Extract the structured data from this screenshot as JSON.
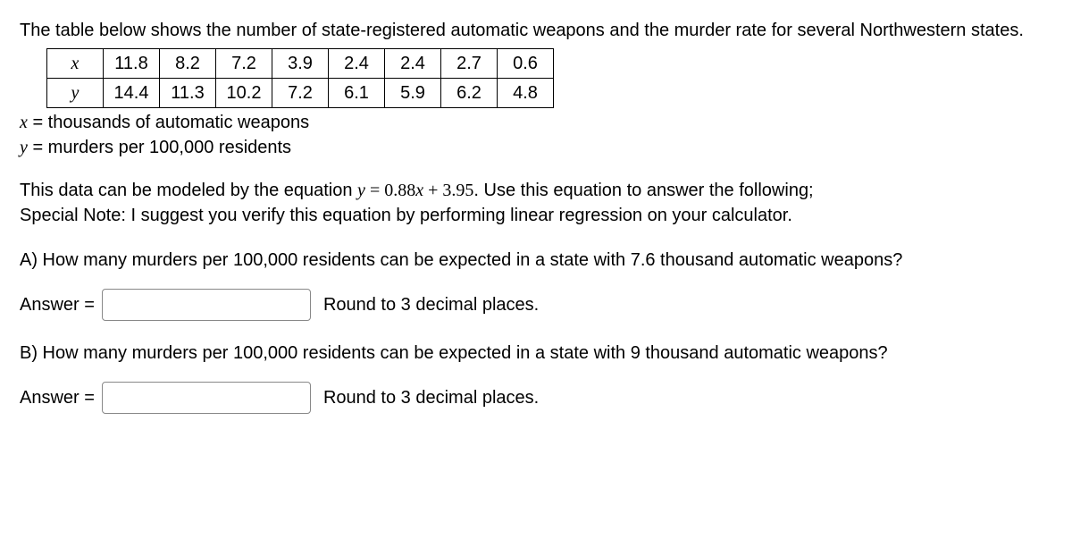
{
  "intro": "The table below shows the number of state-registered automatic weapons and the murder rate for several Northwestern states.",
  "table": {
    "row_x_label": "x",
    "row_y_label": "y",
    "x": [
      "11.8",
      "8.2",
      "7.2",
      "3.9",
      "2.4",
      "2.4",
      "2.7",
      "0.6"
    ],
    "y": [
      "14.4",
      "11.3",
      "10.2",
      "7.2",
      "6.1",
      "5.9",
      "6.2",
      "4.8"
    ]
  },
  "defs": {
    "x_var": "x",
    "x_eq": " = thousands of automatic weapons",
    "y_var": "y",
    "y_eq": " = murders per 100,000 residents"
  },
  "model": {
    "prefix": "This data can be modeled by the equation ",
    "eq_lhs": "y",
    "eq_eq": " = ",
    "eq_rhs_a": "0.88",
    "eq_rhs_x": "x",
    "eq_rhs_b": " + 3.95",
    "period": ".  ",
    "suffix": "Use this equation to answer the following;",
    "note": "Special Note: I suggest you verify this equation by performing linear regression on your calculator."
  },
  "qA": {
    "text": "A) How many murders per 100,000 residents can be expected in a state with 7.6 thousand automatic weapons?",
    "answer_label": "Answer = ",
    "hint": "Round to 3 decimal places."
  },
  "qB": {
    "text": "B) How many murders per 100,000 residents can be expected in a state with 9 thousand automatic weapons?",
    "answer_label": "Answer = ",
    "hint": "Round to 3 decimal places."
  },
  "chart_data": {
    "type": "table",
    "columns": [
      "x (thousands of automatic weapons)",
      "y (murders per 100,000 residents)"
    ],
    "rows": [
      [
        11.8,
        14.4
      ],
      [
        8.2,
        11.3
      ],
      [
        7.2,
        10.2
      ],
      [
        3.9,
        7.2
      ],
      [
        2.4,
        6.1
      ],
      [
        2.4,
        5.9
      ],
      [
        2.7,
        6.2
      ],
      [
        0.6,
        4.8
      ]
    ],
    "regression": {
      "slope": 0.88,
      "intercept": 3.95,
      "equation": "y = 0.88x + 3.95"
    }
  }
}
